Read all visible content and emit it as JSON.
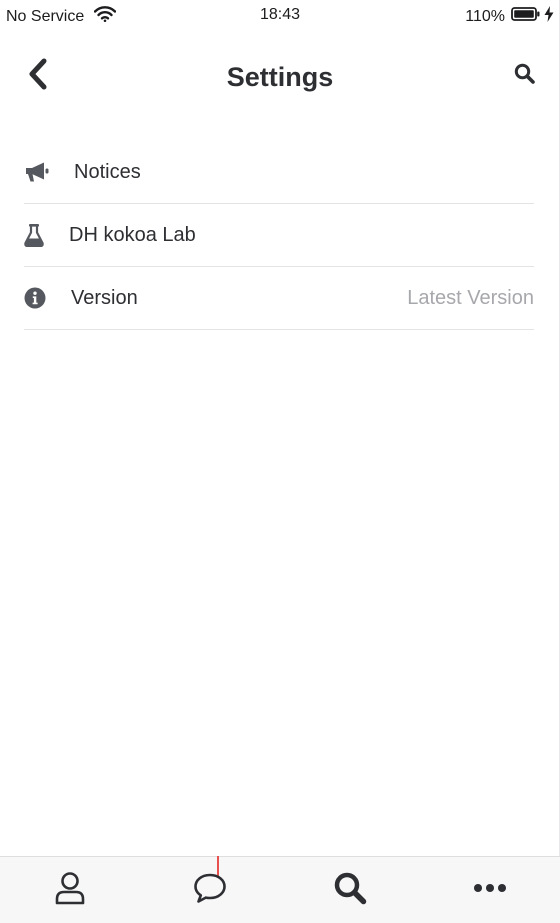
{
  "status_bar": {
    "carrier": "No Service",
    "time": "18:43",
    "battery": "110%",
    "icons": [
      "wifi-icon",
      "battery-icon",
      "charging-bolt-icon"
    ]
  },
  "header": {
    "title": "Settings",
    "back_icon": "chevron-left-icon",
    "search_icon": "search-icon"
  },
  "settings": {
    "items": [
      {
        "icon": "megaphone-icon",
        "label": "Notices",
        "value": ""
      },
      {
        "icon": "flask-icon",
        "label": "DH kokoa Lab",
        "value": ""
      },
      {
        "icon": "info-circle-icon",
        "label": "Version",
        "value": "Latest Version"
      }
    ]
  },
  "tab_bar": {
    "tabs": [
      {
        "icon": "user-icon",
        "name": "friends"
      },
      {
        "icon": "chat-bubble-icon",
        "name": "chats"
      },
      {
        "icon": "search-icon",
        "name": "search"
      },
      {
        "icon": "more-dots-icon",
        "name": "more"
      }
    ]
  },
  "colors": {
    "text": "#2e2f33",
    "muted": "#a7a8ac",
    "divider": "#e4e4e6",
    "tab_bar_bg": "#f7f7f8",
    "icon": "#55585e",
    "notification": "#e85050"
  }
}
